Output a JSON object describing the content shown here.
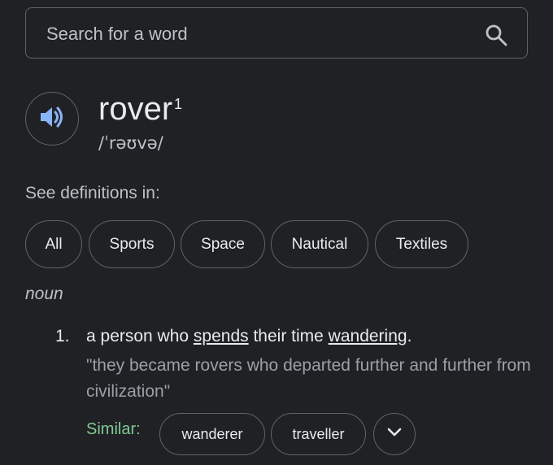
{
  "search": {
    "placeholder": "Search for a word",
    "value": ""
  },
  "entry": {
    "word": "rover",
    "superscript": "1",
    "pronunciation": "/ˈrəʊvə/"
  },
  "see_definitions": {
    "label": "See definitions in:",
    "chips": [
      "All",
      "Sports",
      "Space",
      "Nautical",
      "Textiles"
    ]
  },
  "sense": {
    "part_of_speech": "noun",
    "number": "1.",
    "definition": {
      "part1": "a person who ",
      "link1": "spends",
      "part2": " their time ",
      "link2": "wandering",
      "part3": "."
    },
    "example": "\"they became rovers who departed further and further from civilization\"",
    "similar_label": "Similar:",
    "similar": [
      "wanderer",
      "traveller"
    ]
  },
  "colors": {
    "background": "#202124",
    "border": "#5f6368",
    "accent_speaker": "#8ab4f8",
    "similar_label": "#81c995"
  },
  "icons": {
    "search": "search-icon",
    "speaker": "speaker-icon",
    "expand": "chevron-down-icon"
  }
}
